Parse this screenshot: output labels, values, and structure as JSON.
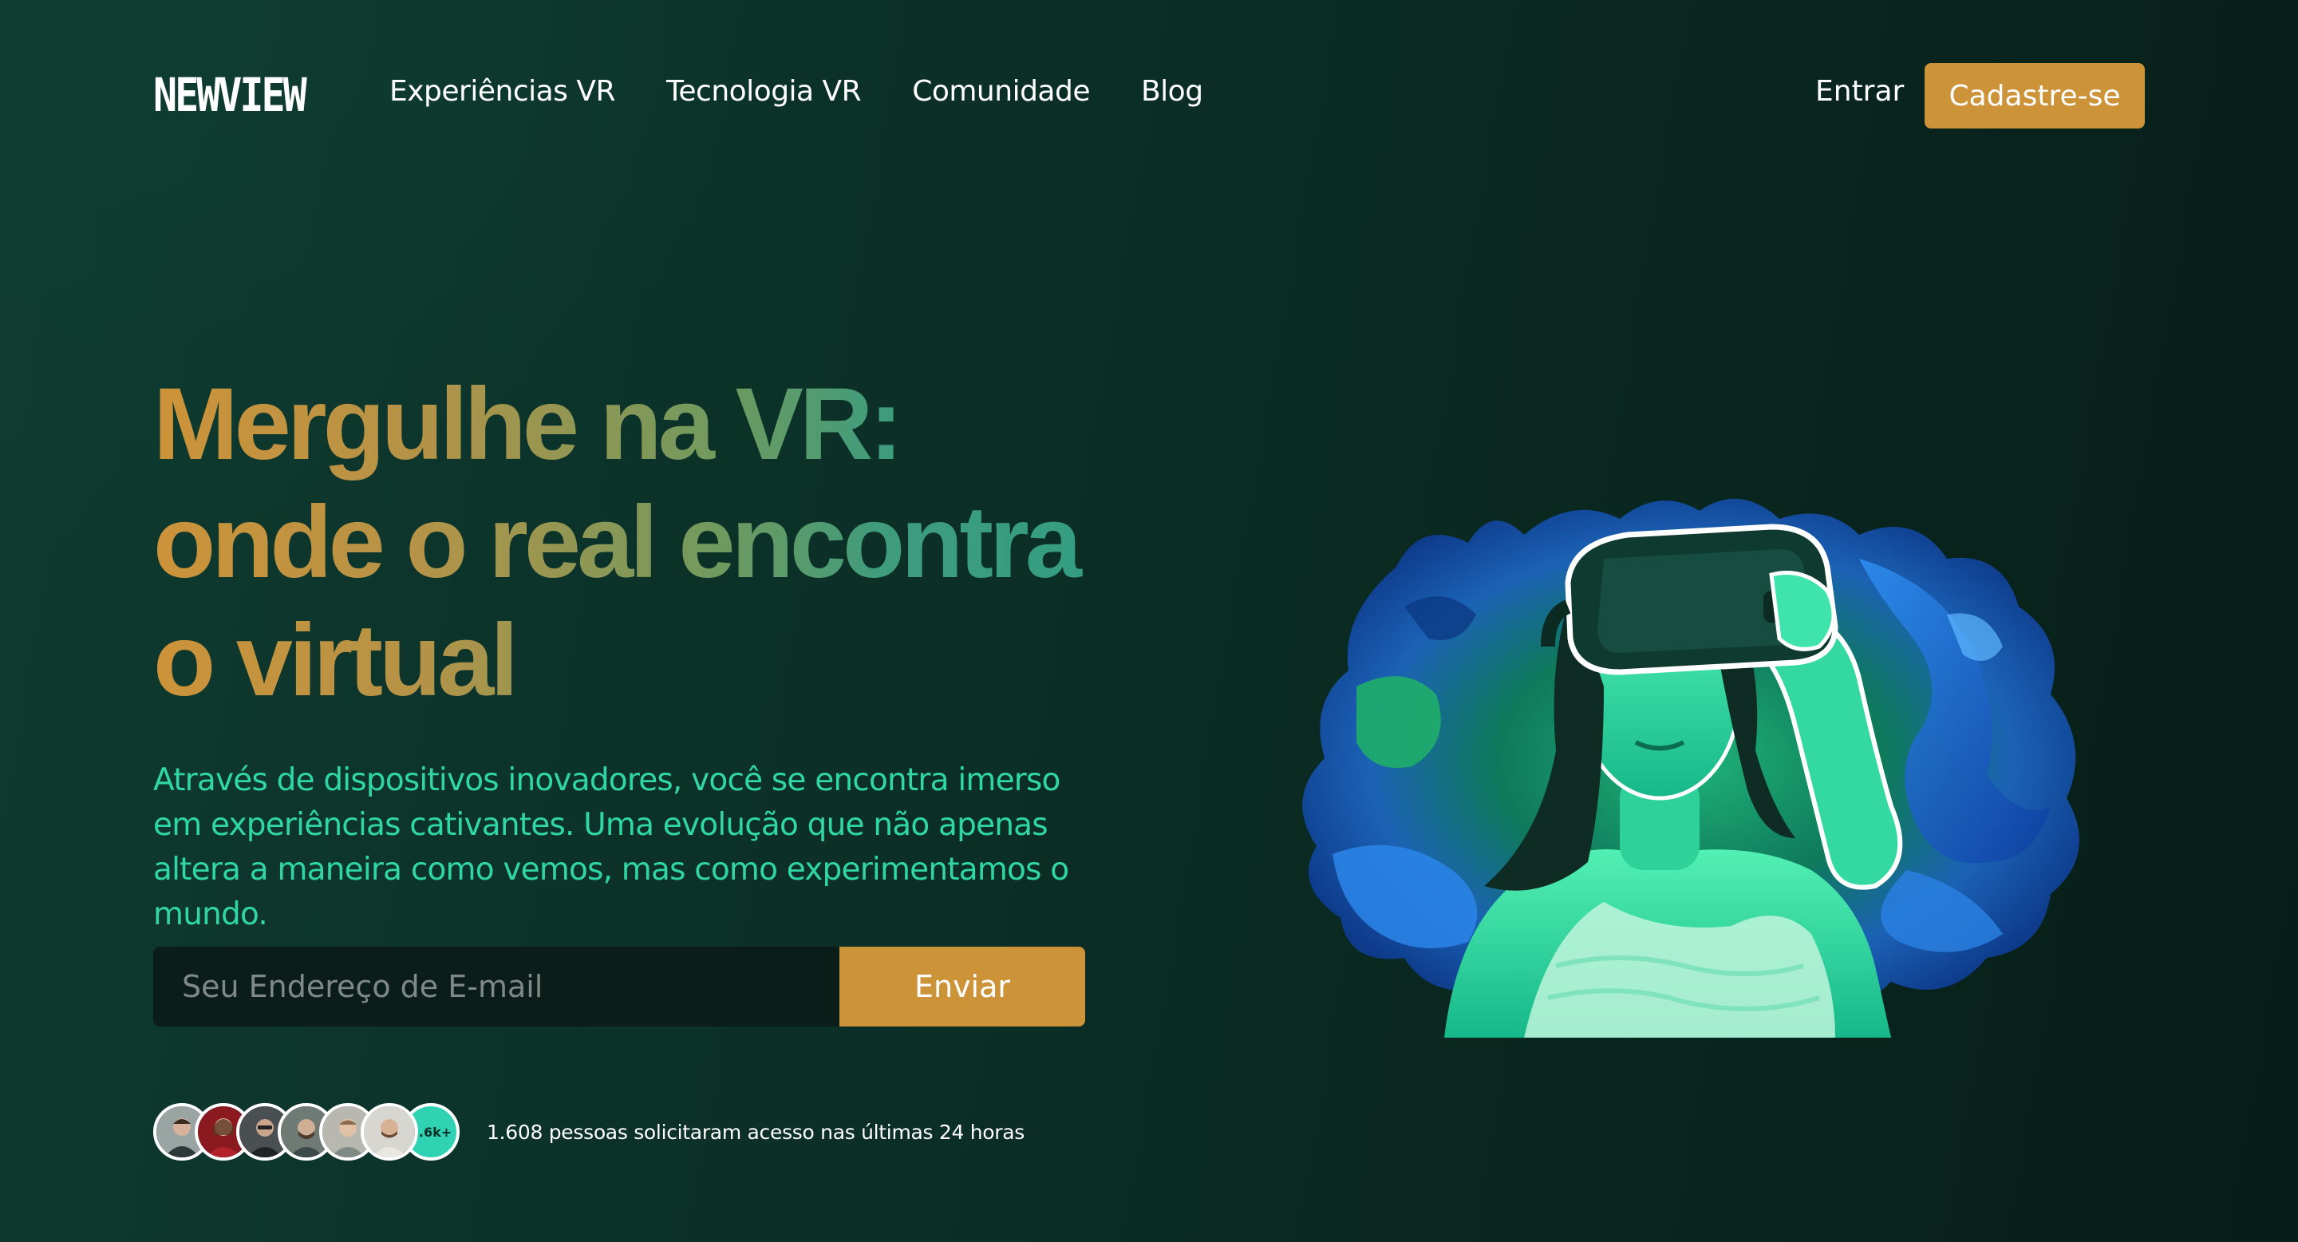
{
  "brand": {
    "logo_text": "NEWVIEW"
  },
  "nav": {
    "links": [
      {
        "label": "Experiências VR"
      },
      {
        "label": "Tecnologia VR"
      },
      {
        "label": "Comunidade"
      },
      {
        "label": "Blog"
      }
    ],
    "login_label": "Entrar",
    "signup_label": "Cadastre-se"
  },
  "hero": {
    "title_lines": [
      "Mergulhe na VR:",
      "onde o real encontra",
      "o virtual"
    ],
    "subtitle": "Através de dispositivos inovadores, você se encontra imerso em experiências cativantes. Uma evolução que não apenas altera a maneira como vemos, mas como experimentamos o mundo.",
    "email_placeholder": "Seu Endereço de E-mail",
    "submit_label": "Enviar"
  },
  "social_proof": {
    "count_badge": "1.6k+",
    "text": "1.608 pessoas solicitaram acesso nas últimas 24 horas"
  },
  "colors": {
    "accent": "#cd9339",
    "mint": "#30d6a4",
    "bg_dark": "#0b2e25"
  }
}
